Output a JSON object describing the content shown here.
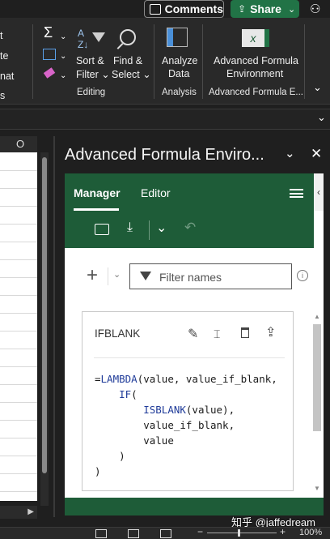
{
  "topbar": {
    "comments_label": "Comments",
    "share_label": "Share"
  },
  "ribbon": {
    "left_items": [
      "t",
      "te",
      "nat",
      "s"
    ],
    "editing": {
      "sort_filter_1": "Sort &",
      "sort_filter_2": "Filter",
      "find_select_1": "Find &",
      "find_select_2": "Select",
      "label": "Editing"
    },
    "analysis": {
      "analyze_1": "Analyze",
      "analyze_2": "Data",
      "label": "Analysis"
    },
    "formula_env": {
      "button_1": "Advanced Formula",
      "button_2": "Environment",
      "label": "Advanced Formula E..."
    }
  },
  "sheet": {
    "column_header": "O"
  },
  "pane": {
    "title": "Advanced Formula Enviro...",
    "tabs": {
      "manager": "Manager",
      "editor": "Editor"
    },
    "filter_placeholder": "Filter names",
    "card": {
      "name": "IFBLANK",
      "code": {
        "l1_prefix": "=",
        "l1_fn": "LAMBDA",
        "l1_rest": "(value, value_if_blank,",
        "l2_fn": "IF",
        "l2_rest": "(",
        "l3_fn": "ISBLANK",
        "l3_rest": "(value),",
        "l4": "value_if_blank,",
        "l5": "value",
        "l6": ")",
        "l7": ")"
      }
    }
  },
  "watermark": "知乎 @jaffedream",
  "status": {
    "zoom": "100%"
  },
  "colors": {
    "accent_green": "#1e5c38",
    "share_green": "#217346",
    "keyword_blue": "#1f3b99"
  }
}
